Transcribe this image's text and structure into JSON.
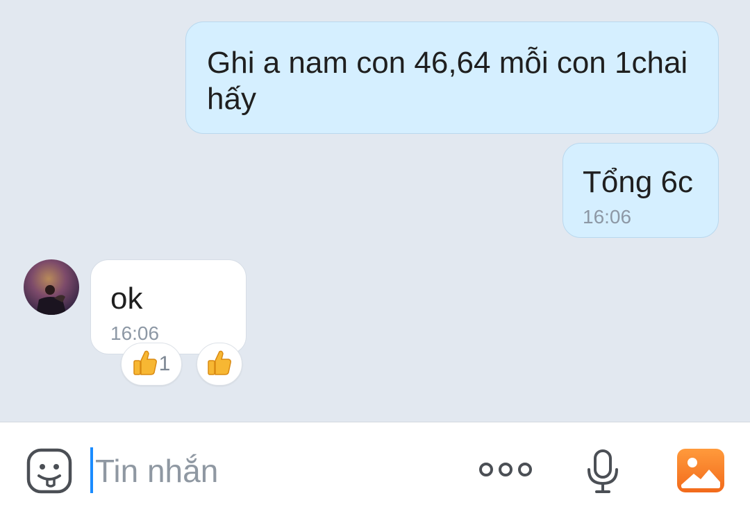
{
  "messages": [
    {
      "direction": "outgoing",
      "text": "Ghi a nam con 46,64 mỗi con 1chai\nhấy",
      "time": ""
    },
    {
      "direction": "outgoing",
      "text": "Tổng 6c",
      "time": "16:06"
    },
    {
      "direction": "incoming",
      "text": "ok",
      "time": "16:06",
      "reactions": [
        {
          "icon": "thumbs-up-icon",
          "count": "1"
        }
      ]
    }
  ],
  "composer": {
    "placeholder": "Tin nhắn",
    "buttons": [
      "sticker-icon",
      "more-options-icon",
      "microphone-icon",
      "image-icon"
    ]
  },
  "colors": {
    "chat_background": "#e2e8f0",
    "outgoing_bubble": "#d5efff",
    "incoming_bubble": "#ffffff",
    "caret": "#1a8cff",
    "image_button": "#f5822a"
  }
}
